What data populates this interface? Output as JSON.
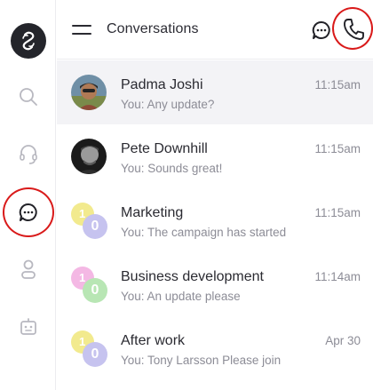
{
  "header": {
    "title": "Conversations",
    "menu_icon": "hamburger-menu-icon",
    "new_chat_icon": "chat-bubble-dots-icon",
    "call_icon": "phone-icon"
  },
  "sidebar": {
    "items": [
      {
        "name": "logo",
        "icon": "brand-logo-icon"
      },
      {
        "name": "search",
        "icon": "search-icon"
      },
      {
        "name": "support",
        "icon": "headset-icon"
      },
      {
        "name": "conversations",
        "icon": "chat-bubble-dots-icon",
        "active": true
      },
      {
        "name": "contacts",
        "icon": "person-icon"
      },
      {
        "name": "bots",
        "icon": "robot-icon"
      }
    ]
  },
  "conversations": [
    {
      "name": "Padma Joshi",
      "preview": "You: Any update?",
      "time": "11:15am",
      "avatar": "photo",
      "selected": true
    },
    {
      "name": "Pete Downhill",
      "preview": "You: Sounds great!",
      "time": "11:15am",
      "avatar": "photo"
    },
    {
      "name": "Marketing",
      "preview": "You: The campaign has started",
      "time": "11:15am",
      "avatar": "group",
      "badge_back": "1",
      "badge_front": "0",
      "back_color": "#f2ea8e",
      "front_color": "#c6c3ef"
    },
    {
      "name": "Business development",
      "preview": "You: An update please",
      "time": "11:14am",
      "avatar": "group",
      "badge_back": "1",
      "badge_front": "0",
      "back_color": "#f4b8e4",
      "front_color": "#b8e6b4"
    },
    {
      "name": "After work",
      "preview": "You: Tony Larsson Please join",
      "time": "Apr 30",
      "avatar": "group",
      "badge_back": "1",
      "badge_front": "0",
      "back_color": "#f2ea8e",
      "front_color": "#c6c3ef"
    }
  ],
  "colors": {
    "highlight_ring": "#d91a1a",
    "selected_row": "#f3f3f6",
    "icon_gray": "#b8b8c0",
    "text_primary": "#2a2a31",
    "text_secondary": "#8c8c96"
  }
}
